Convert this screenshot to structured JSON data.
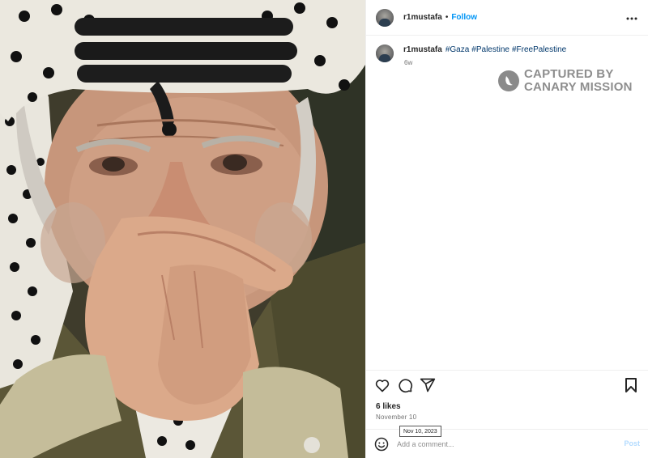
{
  "post": {
    "image_alt": "Photograph of an elderly man wearing a black-and-white keffiyeh, hands clasped against his face"
  },
  "header": {
    "username": "r1mustafa",
    "separator": "•",
    "follow_label": "Follow",
    "more_icon": "more-horizontal-icon"
  },
  "caption": {
    "username": "r1mustafa",
    "hashtags": [
      "#Gaza",
      "#Palestine",
      "#FreePalestine"
    ],
    "time_ago": "6w"
  },
  "watermark": {
    "line1": "CAPTURED BY",
    "line2": "CANARY MISSION"
  },
  "actions": {
    "icons": [
      "heart-icon",
      "comment-icon",
      "share-icon",
      "bookmark-icon"
    ]
  },
  "likes": "6 likes",
  "date": "November 10",
  "tooltip": "Nov 10, 2023",
  "comment": {
    "placeholder": "Add a comment...",
    "post_label": "Post",
    "emoji_icon": "emoji-icon"
  },
  "colors": {
    "link_blue": "#0095f6",
    "hashtag": "#00376b",
    "muted": "#737373",
    "post_disabled": "#b3dbff"
  }
}
